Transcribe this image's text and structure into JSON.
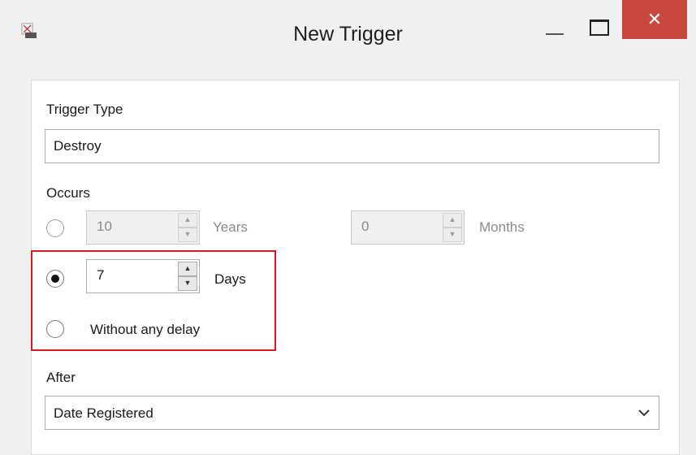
{
  "window": {
    "title": "New Trigger",
    "close_glyph": "✕"
  },
  "form": {
    "trigger_type_label": "Trigger Type",
    "trigger_type_value": "Destroy",
    "occurs_label": "Occurs",
    "years_value": "10",
    "years_unit": "Years",
    "months_value": "0",
    "months_unit": "Months",
    "days_value": "7",
    "days_unit": "Days",
    "no_delay_label": "Without any delay",
    "after_label": "After",
    "after_value": "Date Registered"
  },
  "colors": {
    "highlight": "#e0171c",
    "close": "#c9483e"
  },
  "icons": [
    "app-icon",
    "minimize-icon",
    "maximize-icon",
    "close-icon",
    "chevron-down-icon",
    "spin-up-icon",
    "spin-down-icon"
  ]
}
